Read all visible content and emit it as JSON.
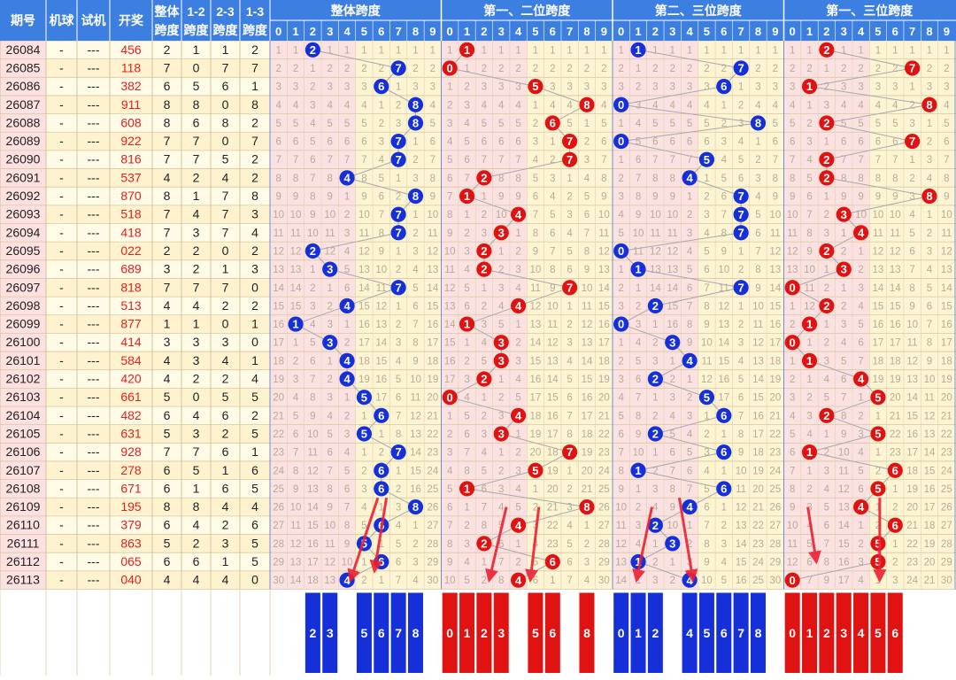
{
  "header": {
    "period": "期号",
    "machine": "机球",
    "trial": "试机",
    "draw": "开奖",
    "overall_top": "整体",
    "overall_bottom": "跨度",
    "s12_top": "1-2",
    "s12_bottom": "跨度",
    "s23_top": "2-3",
    "s23_bottom": "跨度",
    "s13_top": "1-3",
    "s13_bottom": "跨度",
    "section_titles": [
      "整体跨度",
      "第一、二位跨度",
      "第二、三位跨度",
      "第一、三位跨度"
    ],
    "digits": [
      "0",
      "1",
      "2",
      "3",
      "4",
      "5",
      "6",
      "7",
      "8",
      "9"
    ]
  },
  "colors": {
    "header_bg": "#3d7fe0",
    "row_even": "#fffbe6",
    "row_odd": "#fff3cf",
    "period_bg": "#fde0e0",
    "draw_text": "#e02020",
    "ball_blue": "#1530d8",
    "ball_red": "#e01212",
    "zone_pink": "#fbe1e1",
    "zone_cream": "#fcf4d2",
    "arrow": "#ee2030"
  },
  "chart_data": {
    "type": "table",
    "rows": [
      {
        "period": "26084",
        "machine": "-",
        "trial": "---",
        "draw": "456",
        "overall": 2,
        "s12": 1,
        "s23": 1,
        "s13": 2
      },
      {
        "period": "26085",
        "machine": "-",
        "trial": "---",
        "draw": "118",
        "overall": 7,
        "s12": 0,
        "s23": 7,
        "s13": 7
      },
      {
        "period": "26086",
        "machine": "-",
        "trial": "---",
        "draw": "382",
        "overall": 6,
        "s12": 5,
        "s23": 6,
        "s13": 1
      },
      {
        "period": "26087",
        "machine": "-",
        "trial": "---",
        "draw": "911",
        "overall": 8,
        "s12": 8,
        "s23": 0,
        "s13": 8
      },
      {
        "period": "26088",
        "machine": "-",
        "trial": "---",
        "draw": "608",
        "overall": 8,
        "s12": 6,
        "s23": 8,
        "s13": 2
      },
      {
        "period": "26089",
        "machine": "-",
        "trial": "---",
        "draw": "922",
        "overall": 7,
        "s12": 7,
        "s23": 0,
        "s13": 7
      },
      {
        "period": "26090",
        "machine": "-",
        "trial": "---",
        "draw": "816",
        "overall": 7,
        "s12": 7,
        "s23": 5,
        "s13": 2
      },
      {
        "period": "26091",
        "machine": "-",
        "trial": "---",
        "draw": "537",
        "overall": 4,
        "s12": 2,
        "s23": 4,
        "s13": 2
      },
      {
        "period": "26092",
        "machine": "-",
        "trial": "---",
        "draw": "870",
        "overall": 8,
        "s12": 1,
        "s23": 7,
        "s13": 8
      },
      {
        "period": "26093",
        "machine": "-",
        "trial": "---",
        "draw": "518",
        "overall": 7,
        "s12": 4,
        "s23": 7,
        "s13": 3
      },
      {
        "period": "26094",
        "machine": "-",
        "trial": "---",
        "draw": "418",
        "overall": 7,
        "s12": 3,
        "s23": 7,
        "s13": 4
      },
      {
        "period": "26095",
        "machine": "-",
        "trial": "---",
        "draw": "022",
        "overall": 2,
        "s12": 2,
        "s23": 0,
        "s13": 2
      },
      {
        "period": "26096",
        "machine": "-",
        "trial": "---",
        "draw": "689",
        "overall": 3,
        "s12": 2,
        "s23": 1,
        "s13": 3
      },
      {
        "period": "26097",
        "machine": "-",
        "trial": "---",
        "draw": "818",
        "overall": 7,
        "s12": 7,
        "s23": 7,
        "s13": 0
      },
      {
        "period": "26098",
        "machine": "-",
        "trial": "---",
        "draw": "513",
        "overall": 4,
        "s12": 4,
        "s23": 2,
        "s13": 2
      },
      {
        "period": "26099",
        "machine": "-",
        "trial": "---",
        "draw": "877",
        "overall": 1,
        "s12": 1,
        "s23": 0,
        "s13": 1
      },
      {
        "period": "26100",
        "machine": "-",
        "trial": "---",
        "draw": "414",
        "overall": 3,
        "s12": 3,
        "s23": 3,
        "s13": 0
      },
      {
        "period": "26101",
        "machine": "-",
        "trial": "---",
        "draw": "584",
        "overall": 4,
        "s12": 3,
        "s23": 4,
        "s13": 1
      },
      {
        "period": "26102",
        "machine": "-",
        "trial": "---",
        "draw": "420",
        "overall": 4,
        "s12": 2,
        "s23": 2,
        "s13": 4
      },
      {
        "period": "26103",
        "machine": "-",
        "trial": "---",
        "draw": "661",
        "overall": 5,
        "s12": 0,
        "s23": 5,
        "s13": 5
      },
      {
        "period": "26104",
        "machine": "-",
        "trial": "---",
        "draw": "482",
        "overall": 6,
        "s12": 4,
        "s23": 6,
        "s13": 2
      },
      {
        "period": "26105",
        "machine": "-",
        "trial": "---",
        "draw": "631",
        "overall": 5,
        "s12": 3,
        "s23": 2,
        "s13": 5
      },
      {
        "period": "26106",
        "machine": "-",
        "trial": "---",
        "draw": "928",
        "overall": 7,
        "s12": 7,
        "s23": 6,
        "s13": 1
      },
      {
        "period": "26107",
        "machine": "-",
        "trial": "---",
        "draw": "278",
        "overall": 6,
        "s12": 5,
        "s23": 1,
        "s13": 6
      },
      {
        "period": "26108",
        "machine": "-",
        "trial": "---",
        "draw": "671",
        "overall": 6,
        "s12": 1,
        "s23": 6,
        "s13": 5
      },
      {
        "period": "26109",
        "machine": "-",
        "trial": "---",
        "draw": "195",
        "overall": 8,
        "s12": 8,
        "s23": 4,
        "s13": 4
      },
      {
        "period": "26110",
        "machine": "-",
        "trial": "---",
        "draw": "379",
        "overall": 6,
        "s12": 4,
        "s23": 2,
        "s13": 6
      },
      {
        "period": "26111",
        "machine": "-",
        "trial": "---",
        "draw": "863",
        "overall": 5,
        "s12": 2,
        "s23": 3,
        "s13": 5
      },
      {
        "period": "26112",
        "machine": "-",
        "trial": "---",
        "draw": "065",
        "overall": 6,
        "s12": 6,
        "s23": 1,
        "s13": 5
      },
      {
        "period": "26113",
        "machine": "-",
        "trial": "---",
        "draw": "040",
        "overall": 4,
        "s12": 4,
        "s23": 4,
        "s13": 0
      }
    ],
    "predictions": {
      "overall": [
        2,
        3,
        5,
        6,
        7,
        8
      ],
      "s12": [
        0,
        1,
        2,
        3,
        5,
        6,
        8
      ],
      "s23": [
        0,
        1,
        2,
        4,
        5,
        6,
        7,
        8
      ],
      "s13": [
        0,
        1,
        2,
        3,
        4,
        5,
        6
      ]
    }
  }
}
